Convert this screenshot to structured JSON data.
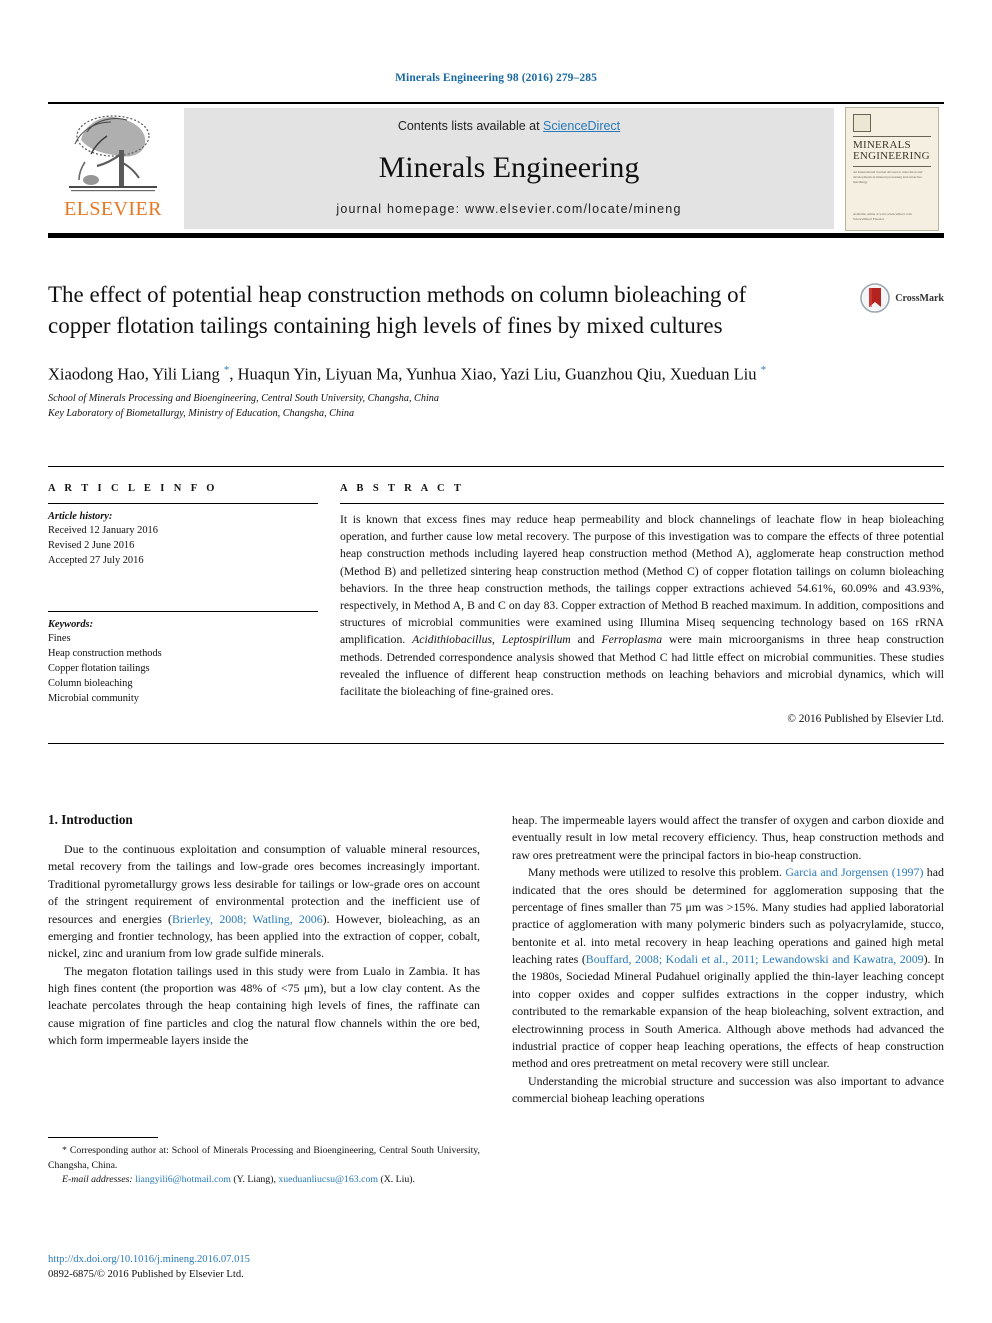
{
  "running_head": "Minerals Engineering 98 (2016) 279–285",
  "masthead": {
    "elsevier_wordmark": "ELSEVIER",
    "contents_prefix": "Contents lists available at ",
    "sciencedirect": "ScienceDirect",
    "journal_name": "Minerals Engineering",
    "homepage": "journal homepage: www.elsevier.com/locate/mineng",
    "cover": {
      "line1": "MINERALS",
      "line2": "ENGINEERING",
      "blurb": "An International Journal devoted to innovation and developments in mineral processing and extractive metallurgy",
      "footer": "Available online at www.sciencedirect.com  ScienceDirect  Elsevier"
    }
  },
  "article": {
    "title": "The effect of potential heap construction methods on column bioleaching of copper flotation tailings containing high levels of fines by mixed cultures",
    "crossmark_label": "CrossMark",
    "authors_html": "Xiaodong Hao, Yili Liang <sup>*</sup>, Huaqun Yin, Liyuan Ma, Yunhua Xiao, Yazi Liu, Guanzhou Qiu, Xueduan Liu <sup>*</sup>",
    "affiliation_1": "School of Minerals Processing and Bioengineering, Central South University, Changsha, China",
    "affiliation_2": "Key Laboratory of Biometallurgy, Ministry of Education, Changsha, China"
  },
  "article_info": {
    "heading": "A R T I C L E   I N F O",
    "history_label": "Article history:",
    "history": [
      "Received 12 January 2016",
      "Revised 2 June 2016",
      "Accepted 27 July 2016"
    ],
    "keywords_label": "Keywords:",
    "keywords": [
      "Fines",
      "Heap construction methods",
      "Copper flotation tailings",
      "Column bioleaching",
      "Microbial community"
    ]
  },
  "abstract": {
    "heading": "A B S T R A C T",
    "text_html": "It is known that excess fines may reduce heap permeability and block channelings of leachate flow in heap bioleaching operation, and further cause low metal recovery. The purpose of this investigation was to compare the effects of three potential heap construction methods including layered heap construction method (Method A), agglomerate heap construction method (Method B) and pelletized sintering heap construction method (Method C) of copper flotation tailings on column bioleaching behaviors. In the three heap construction methods, the tailings copper extractions achieved 54.61%, 60.09% and 43.93%, respectively, in Method A, B and C on day 83. Copper extraction of Method B reached maximum. In addition, compositions and structures of microbial communities were examined using Illumina Miseq sequencing technology based on 16S rRNA amplification. <i>Acidithiobacillus</i>, <i>Leptospirillum</i> and <i>Ferroplasma</i> were main microorganisms in three heap construction methods. Detrended correspondence analysis showed that Method C had little effect on microbial communities. These studies revealed the influence of different heap construction methods on leaching behaviors and microbial dynamics, which will facilitate the bioleaching of fine-grained ores.",
    "copyright": "© 2016 Published by Elsevier Ltd."
  },
  "body": {
    "section_heading": "1. Introduction",
    "left_paragraphs_html": [
      "Due to the continuous exploitation and consumption of valuable mineral resources, metal recovery from the tailings and low-grade ores becomes increasingly important. Traditional pyrometallurgy grows less desirable for tailings or low-grade ores on account of the stringent requirement of environmental protection and the inefficient use of resources and energies (<span class=\"lnk\">Brierley, 2008; Watling, 2006</span>). However, bioleaching, as an emerging and frontier technology, has been applied into the extraction of copper, cobalt, nickel, zinc and uranium from low grade sulfide minerals.",
      "The megaton flotation tailings used in this study were from Lualo in Zambia. It has high fines content (the proportion was 48% of &lt;75 μm), but a low clay content. As the leachate percolates through the heap containing high levels of fines, the raffinate can cause migration of fine particles and clog the natural flow channels within the ore bed, which form impermeable layers inside the"
    ],
    "right_paragraphs_html": [
      "heap. The impermeable layers would affect the transfer of oxygen and carbon dioxide and eventually result in low metal recovery efficiency. Thus, heap construction methods and raw ores pretreatment were the principal factors in bio-heap construction.",
      "Many methods were utilized to resolve this problem. <span class=\"lnk\">Garcia and Jorgensen (1997)</span> had indicated that the ores should be determined for agglomeration supposing that the percentage of fines smaller than 75 μm was &gt;15%. Many studies had applied laboratorial practice of agglomeration with many polymeric binders such as polyacrylamide, stucco, bentonite et al. into metal recovery in heap leaching operations and gained high metal leaching rates (<span class=\"lnk\">Bouffard, 2008; Kodali et al., 2011; Lewandowski and Kawatra, 2009</span>). In the 1980s, Sociedad Mineral Pudahuel originally applied the thin-layer leaching concept into copper oxides and copper sulfides extractions in the copper industry, which contributed to the remarkable expansion of the heap bioleaching, solvent extraction, and electrowinning process in South America. Although above methods had advanced the industrial practice of copper heap leaching operations, the effects of heap construction method and ores pretreatment on metal recovery were still unclear.",
      "Understanding the microbial structure and succession was also important to advance commercial bioheap leaching operations"
    ]
  },
  "footnotes": {
    "corresponding_html": "* Corresponding author at: School of Minerals Processing and Bioengineering, Central South University, Changsha, China.",
    "emails_html": "<i>E-mail addresses:</i> <span class=\"lnk\">liangyili6@hotmail.com</span> (Y. Liang), <span class=\"lnk\">xueduanliucsu@163.com</span> (X. Liu).",
    "doi": "http://dx.doi.org/10.1016/j.mineng.2016.07.015",
    "issn_line": "0892-6875/© 2016 Published by Elsevier Ltd."
  },
  "colors": {
    "link_blue": "#2a7ab9",
    "running_head_blue": "#1a6aa2",
    "elsevier_orange": "#E87722",
    "panel_gray": "#e3e3e3"
  }
}
